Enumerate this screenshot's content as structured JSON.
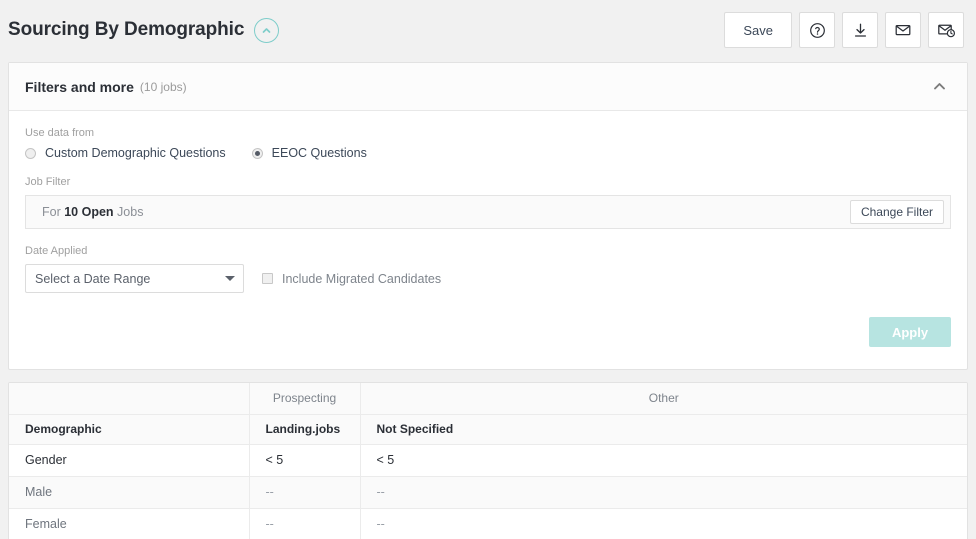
{
  "page": {
    "title": "Sourcing By Demographic",
    "title_toggle_icon": "chevron-up-circle-icon",
    "accent_color": "#7ecdca",
    "background_color": "#f1f1f1"
  },
  "header_actions": [
    {
      "name": "save-button",
      "label": "Save",
      "icon": null
    },
    {
      "name": "help-button",
      "label": "",
      "icon": "question-circle-icon"
    },
    {
      "name": "download-button",
      "label": "",
      "icon": "download-icon"
    },
    {
      "name": "email-button",
      "label": "",
      "icon": "envelope-icon"
    },
    {
      "name": "schedule-email-button",
      "label": "",
      "icon": "envelope-clock-icon"
    }
  ],
  "filters": {
    "title": "Filters and more",
    "subtitle": "(10 jobs)",
    "collapse_icon": "chevron-up-icon",
    "use_data_from": {
      "label": "Use data from",
      "options": [
        {
          "label": "Custom Demographic Questions",
          "selected": false
        },
        {
          "label": "EEOC Questions",
          "selected": true
        }
      ]
    },
    "job_filter": {
      "label": "Job Filter",
      "text_prefix": "For ",
      "text_bold": "10 Open",
      "text_suffix": " Jobs",
      "change_button_label": "Change Filter"
    },
    "date_applied": {
      "label": "Date Applied",
      "selected_value": "Select a Date Range",
      "caret_icon": "chevron-down-icon"
    },
    "include_migrated": {
      "label": "Include Migrated Candidates",
      "checked": false
    },
    "apply_button": {
      "label": "Apply",
      "color": "#b7e4e1",
      "enabled": false
    }
  },
  "table": {
    "group_headers": [
      "",
      "Prospecting",
      "Other"
    ],
    "column_headers": [
      "Demographic",
      "Landing.jobs",
      "Not Specified"
    ],
    "rows": [
      {
        "label": "Gender",
        "type": "category",
        "values": [
          "< 5",
          "< 5"
        ]
      },
      {
        "label": "Male",
        "type": "sub",
        "values": [
          "--",
          "--"
        ]
      },
      {
        "label": "Female",
        "type": "sub",
        "values": [
          "--",
          "--"
        ]
      }
    ]
  }
}
